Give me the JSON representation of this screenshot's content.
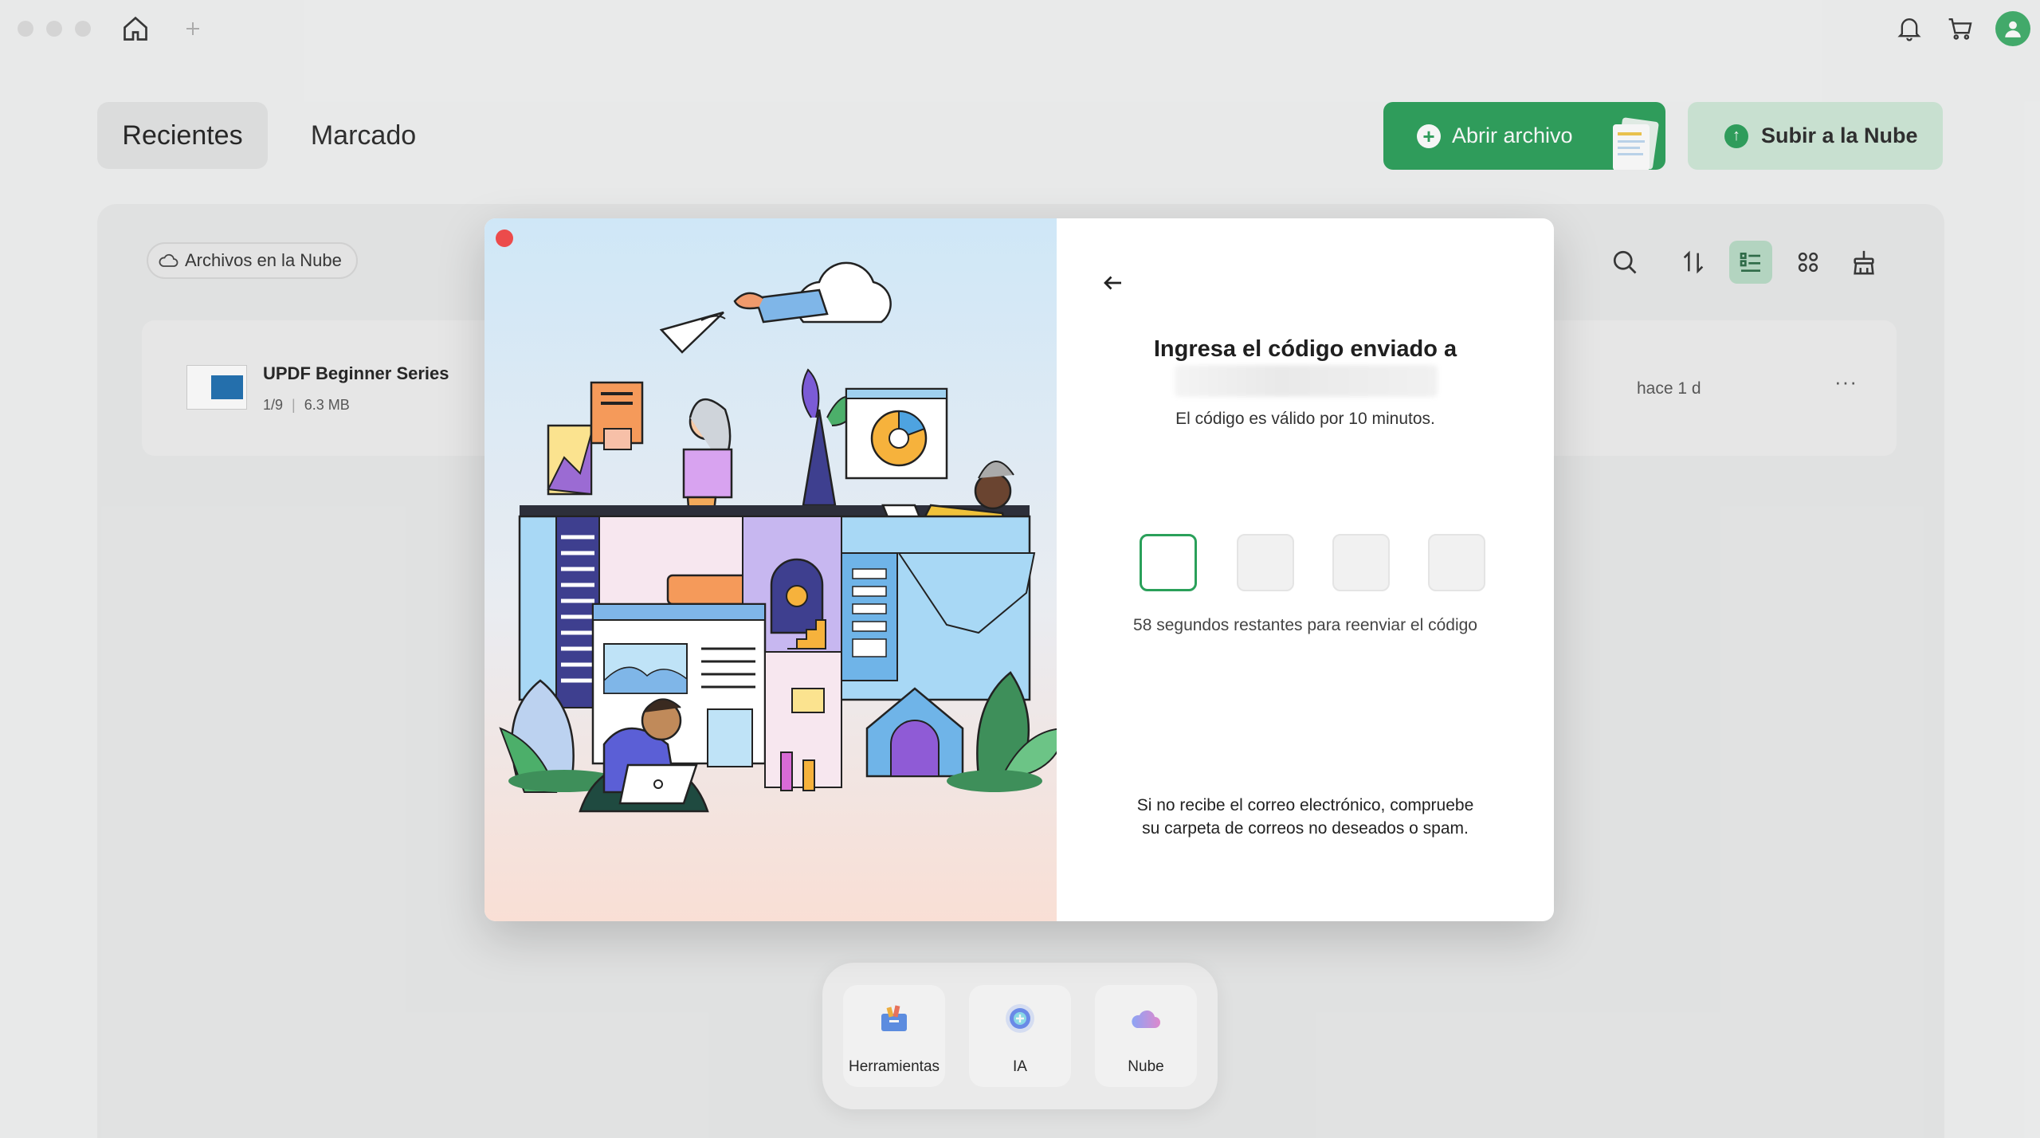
{
  "window": {
    "traffic_lights": [
      "close",
      "minimize",
      "zoom"
    ],
    "home_icon": "home-icon",
    "new_tab_icon": "plus-icon",
    "bell_icon": "bell-icon",
    "cart_icon": "cart-icon",
    "avatar_icon": "user-icon"
  },
  "tabs": [
    {
      "label": "Recientes",
      "active": true
    },
    {
      "label": "Marcado",
      "active": false
    }
  ],
  "actions": {
    "open_file": "Abrir archivo",
    "upload_cloud": "Subir a la Nube"
  },
  "filter_chip": "Archivos en la Nube",
  "toolbar": [
    "search-icon",
    "sort-icon",
    "list-view-icon",
    "grid-view-icon",
    "clean-icon"
  ],
  "files": [
    {
      "name": "UPDF Beginner Series",
      "pages": "1/9",
      "size": "6.3 MB",
      "modified": "hace 1 d",
      "more": "···"
    }
  ],
  "dock": [
    {
      "label": "Herramientas",
      "icon": "toolbox-icon"
    },
    {
      "label": "IA",
      "icon": "ai-icon"
    },
    {
      "label": "Nube",
      "icon": "cloud-icon"
    }
  ],
  "modal": {
    "title": "Ingresa el código enviado a",
    "validity": "El código es válido por 10 minutos.",
    "code_digits": [
      "",
      "",
      "",
      ""
    ],
    "resend_text": "58 segundos restantes para reenviar el código",
    "spam_text": "Si no recibe el correo electrónico, compruebe su carpeta de correos no deseados o spam."
  },
  "colors": {
    "accent": "#2aa05a",
    "accent_light": "#cfe9d8",
    "close_red": "#ec4b4b"
  }
}
